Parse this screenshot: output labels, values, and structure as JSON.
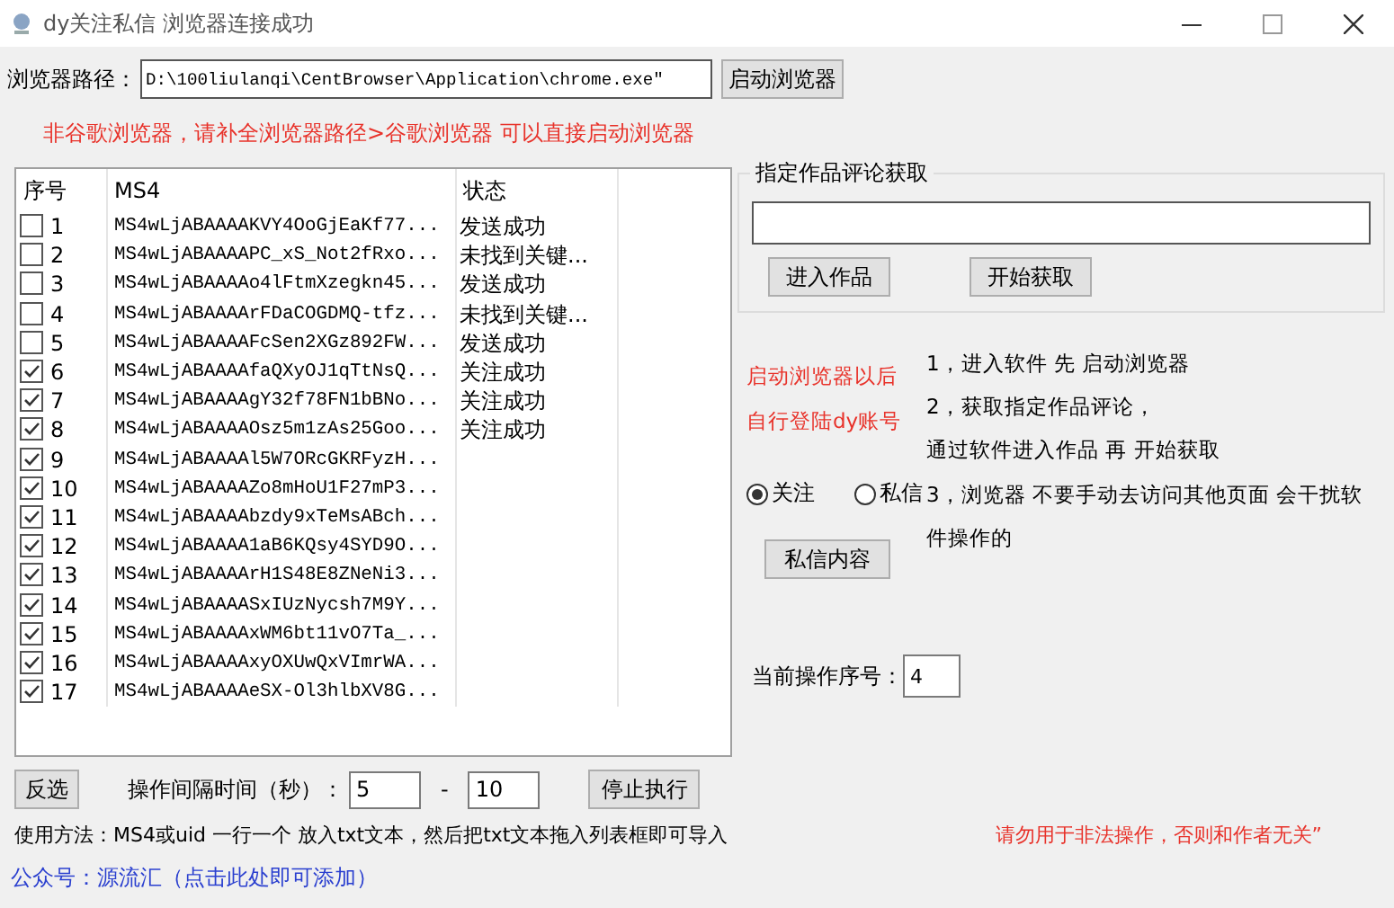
{
  "window": {
    "title": "dy关注私信 浏览器连接成功"
  },
  "browser_path": {
    "label": "浏览器路径：",
    "value": "D:\\100liulanqi\\CentBrowser\\Application\\chrome.exe\"",
    "button": "启动浏览器"
  },
  "hint": "非谷歌浏览器，请补全浏览器路径>谷歌浏览器 可以直接启动浏览器",
  "list": {
    "columns": [
      "序号",
      "MS4",
      "状态"
    ],
    "rows": [
      {
        "index": "1",
        "checked": false,
        "ms4": "MS4wLjABAAAAKVY4OoGjEaKf77...",
        "status": "发送成功"
      },
      {
        "index": "2",
        "checked": false,
        "ms4": "MS4wLjABAAAAPC_xS_Not2fRxo...",
        "status": "未找到关键..."
      },
      {
        "index": "3",
        "checked": false,
        "ms4": "MS4wLjABAAAAo4lFtmXzegkn45...",
        "status": "发送成功"
      },
      {
        "index": "4",
        "checked": false,
        "ms4": "MS4wLjABAAAArFDaCOGDMQ-tfz...",
        "status": "未找到关键..."
      },
      {
        "index": "5",
        "checked": false,
        "ms4": "MS4wLjABAAAAFcSen2XGz892FW...",
        "status": "发送成功"
      },
      {
        "index": "6",
        "checked": true,
        "ms4": "MS4wLjABAAAAfaQXyOJ1qTtNsQ...",
        "status": "关注成功"
      },
      {
        "index": "7",
        "checked": true,
        "ms4": "MS4wLjABAAAAgY32f78FN1bBNo...",
        "status": "关注成功"
      },
      {
        "index": "8",
        "checked": true,
        "ms4": "MS4wLjABAAAAOsz5m1zAs25Goo...",
        "status": "关注成功"
      },
      {
        "index": "9",
        "checked": true,
        "ms4": "MS4wLjABAAAAl5W7ORcGKRFyzH..."
      },
      {
        "index": "10",
        "checked": true,
        "ms4": "MS4wLjABAAAAZo8mHoU1F27mP3..."
      },
      {
        "index": "11",
        "checked": true,
        "ms4": "MS4wLjABAAAAbzdy9xTeMsABch..."
      },
      {
        "index": "12",
        "checked": true,
        "ms4": "MS4wLjABAAAA1aB6KQsy4SYD9O..."
      },
      {
        "index": "13",
        "checked": true,
        "ms4": "MS4wLjABAAAArH1S48E8ZNeNi3..."
      },
      {
        "index": "14",
        "checked": true,
        "ms4": "MS4wLjABAAAASxIUzNycsh7M9Y..."
      },
      {
        "index": "15",
        "checked": true,
        "ms4": "MS4wLjABAAAAxWM6bt11vO7Ta_..."
      },
      {
        "index": "16",
        "checked": true,
        "ms4": "MS4wLjABAAAAxyOXUwQxVImrWA..."
      },
      {
        "index": "17",
        "checked": true,
        "ms4": "MS4wLjABAAAAeSX-Ol3hlbXV8G..."
      }
    ]
  },
  "comment_group": {
    "title": "指定作品评论获取",
    "buttons": [
      "进入作品",
      "开始获取"
    ]
  },
  "login_note": [
    "启动浏览器以后",
    "自行登陆dy账号"
  ],
  "instructions": [
    "1，进入软件 先 启动浏览器",
    "2，获取指定作品评论，",
    "通过软件进入作品 再 开始获取",
    "3，浏览器 不要手动去访问其他页面 会干扰软件操作的"
  ],
  "modes": [
    {
      "label": "关注",
      "selected": true
    },
    {
      "label": "私信",
      "selected": false
    }
  ],
  "dm_button": "私信内容",
  "current": {
    "label": "当前操作序号：",
    "value": "4"
  },
  "invert_button": "反选",
  "interval": {
    "label": "操作间隔时间（秒）：",
    "min": "5",
    "separator": "-",
    "max": "10"
  },
  "stop_button": "停止执行",
  "usage": "使用方法：MS4或uid 一行一个 放入txt文本，然后把txt文本拖入列表框即可导入",
  "warning": "请勿用于非法操作，否则和作者无关”",
  "footer_link": "公众号：源流汇（点击此处即可添加）"
}
